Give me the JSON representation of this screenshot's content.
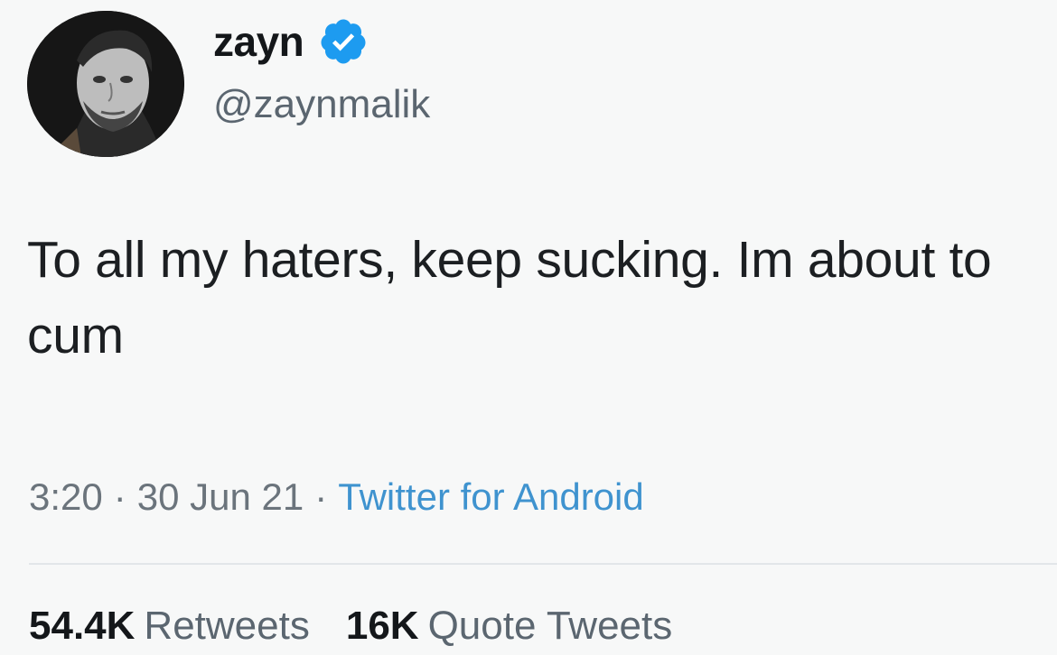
{
  "user": {
    "display_name": "zayn",
    "handle": "@zaynmalik",
    "verified": true,
    "avatar": "profile-photo"
  },
  "tweet": {
    "text": "To all my haters, keep sucking. Im about to cum",
    "time": "3:20",
    "date": "30 Jun 21",
    "source": "Twitter for Android",
    "separator": "·"
  },
  "stats": {
    "retweets_count": "54.4K",
    "retweets_label": "Retweets",
    "quotes_count": "16K",
    "quotes_label": "Quote Tweets"
  },
  "colors": {
    "background": "#f7f8f8",
    "text": "#14171a",
    "secondary_text": "#5b6670",
    "link": "#3f93cf",
    "verified": "#1d9bf0"
  }
}
